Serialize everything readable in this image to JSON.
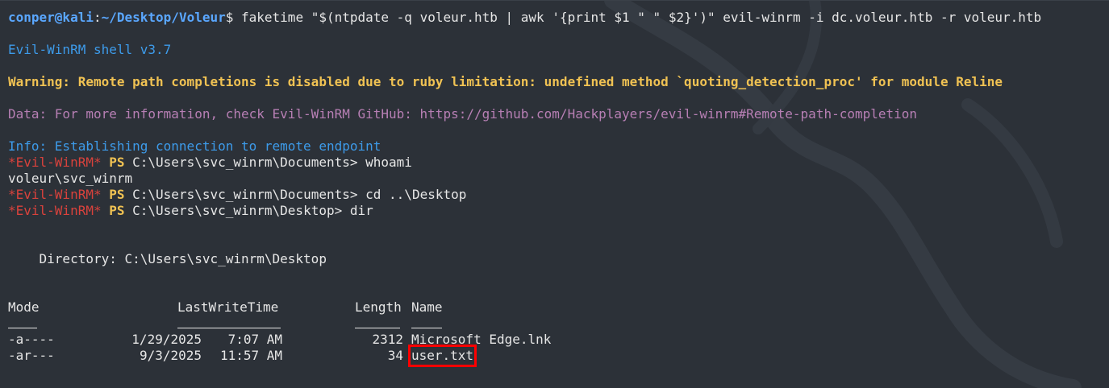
{
  "prompt": {
    "user_host": "conper@kali",
    "sep": ":",
    "path": "~/Desktop/Voleur",
    "symbol": "$",
    "command": " faketime \"$(ntpdate -q voleur.htb | awk '{print $1 \" \" $2}')\" evil-winrm -i dc.voleur.htb -r voleur.htb"
  },
  "banner": "Evil-WinRM shell v3.7",
  "warning": "Warning: Remote path completions is disabled due to ruby limitation: undefined method `quoting_detection_proc' for module Reline",
  "data_line": "Data: For more information, check Evil-WinRM GitHub: https://github.com/Hackplayers/evil-winrm#Remote-path-completion",
  "info_line": "Info: Establishing connection to remote endpoint",
  "shell_lines": [
    {
      "tag": "*Evil-WinRM*",
      "ps": "PS",
      "path": "C:\\Users\\svc_winrm\\Documents>",
      "cmd": "whoami"
    },
    {
      "output": "voleur\\svc_winrm"
    },
    {
      "tag": "*Evil-WinRM*",
      "ps": "PS",
      "path": "C:\\Users\\svc_winrm\\Documents>",
      "cmd": "cd ..\\Desktop"
    },
    {
      "tag": "*Evil-WinRM*",
      "ps": "PS",
      "path": "C:\\Users\\svc_winrm\\Desktop>",
      "cmd": "dir"
    }
  ],
  "directory_line": "    Directory: C:\\Users\\svc_winrm\\Desktop",
  "table": {
    "headers": {
      "mode": "Mode",
      "time": "LastWriteTime",
      "length": "Length",
      "name": "Name"
    },
    "rows": [
      {
        "mode": "-a----",
        "date": "1/29/2025",
        "time": "7:07 AM",
        "length": "2312",
        "name": "Microsoft Edge.lnk"
      },
      {
        "mode": "-ar---",
        "date": "9/3/2025",
        "time": "11:57 AM",
        "length": "34",
        "name": "user.txt"
      }
    ]
  },
  "colors": {
    "background": "#2c3138",
    "prompt_blue": "#5aa7ff",
    "warning": "#f0c253",
    "data": "#b77fb4",
    "evil_tag": "#d9423c",
    "highlight_box": "#ff0000"
  }
}
